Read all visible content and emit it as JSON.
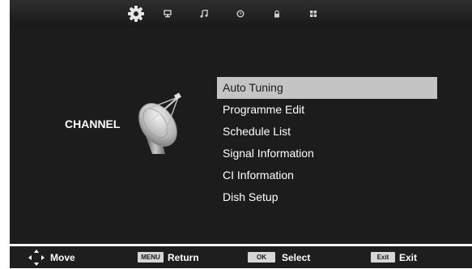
{
  "category": {
    "label": "CHANNEL"
  },
  "top_icons": [
    {
      "name": "settings-gear-icon",
      "active": true
    },
    {
      "name": "monitor-icon",
      "active": false
    },
    {
      "name": "music-note-icon",
      "active": false
    },
    {
      "name": "clock-icon",
      "active": false
    },
    {
      "name": "lock-icon",
      "active": false
    },
    {
      "name": "grid-icon",
      "active": false
    }
  ],
  "menu": {
    "selected_index": 0,
    "items": [
      {
        "label": "Auto Tuning"
      },
      {
        "label": "Programme Edit"
      },
      {
        "label": "Schedule List"
      },
      {
        "label": "Signal Information"
      },
      {
        "label": "CI Information"
      },
      {
        "label": "Dish Setup"
      }
    ]
  },
  "footer": {
    "move": {
      "icon": "arrows-icon",
      "label": "Move"
    },
    "return": {
      "key": "MENU",
      "label": "Return"
    },
    "select": {
      "key": "OK",
      "label": "Select"
    },
    "exit": {
      "key": "Exit",
      "label": "Exit"
    }
  },
  "colors": {
    "panel": "#1c1c1c",
    "selected_bg": "#c4c4c4",
    "text": "#ffffff"
  }
}
